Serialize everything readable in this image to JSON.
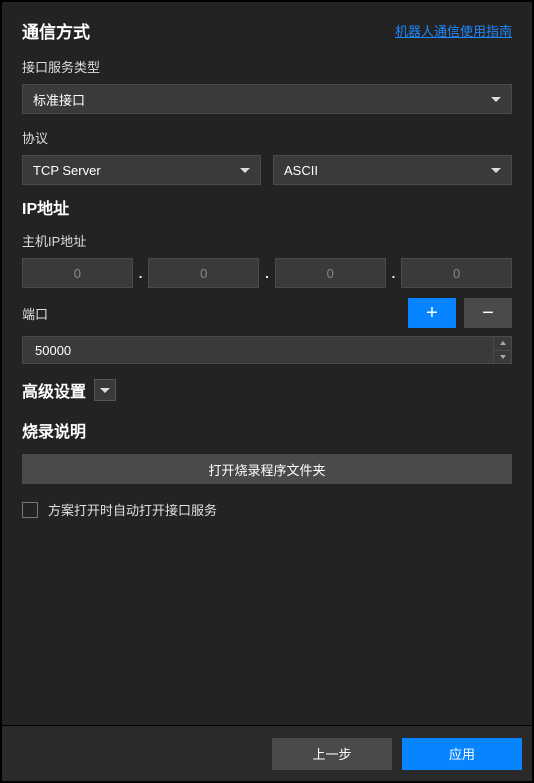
{
  "header": {
    "title": "通信方式",
    "help_link": "机器人通信使用指南"
  },
  "interface_type": {
    "label": "接口服务类型",
    "selected": "标准接口"
  },
  "protocol": {
    "label": "协议",
    "transport_selected": "TCP Server",
    "encoding_selected": "ASCII"
  },
  "ip_section": {
    "title": "IP地址",
    "host_label": "主机IP地址",
    "octets": [
      "0",
      "0",
      "0",
      "0"
    ],
    "port_label": "端口",
    "port_value": "50000"
  },
  "advanced": {
    "title": "高级设置"
  },
  "burn": {
    "title": "烧录说明",
    "open_button": "打开烧录程序文件夹"
  },
  "auto_open": {
    "label": "方案打开时自动打开接口服务",
    "checked": false
  },
  "footer": {
    "prev": "上一步",
    "apply": "应用"
  }
}
